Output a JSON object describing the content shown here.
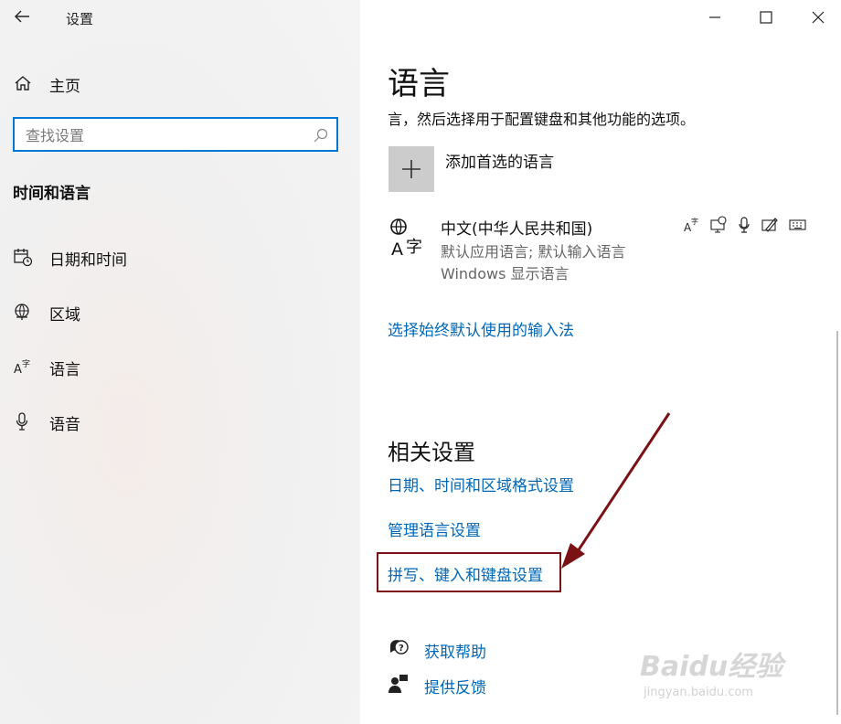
{
  "app": {
    "title": "设置"
  },
  "sidebar": {
    "home_label": "主页",
    "search_placeholder": "查找设置",
    "group_heading": "时间和语言",
    "items": [
      {
        "label": "日期和时间",
        "icon": "calendar-clock-icon"
      },
      {
        "label": "区域",
        "icon": "globe-icon"
      },
      {
        "label": "语言",
        "icon": "language-icon"
      },
      {
        "label": "语音",
        "icon": "microphone-icon"
      }
    ]
  },
  "main": {
    "title": "语言",
    "description": "言，然后选择用于配置键盘和其他功能的选项。",
    "add_language_label": "添加首选的语言",
    "language": {
      "name": "中文(中华人民共和国)",
      "line1": "默认应用语言; 默认输入语言",
      "line2": "Windows 显示语言",
      "feature_icons": [
        "display-language-icon",
        "text-to-speech-icon",
        "speech-recognition-icon",
        "handwriting-icon",
        "keyboard-icon"
      ]
    },
    "input_method_link": "选择始终默认使用的输入法",
    "related_heading": "相关设置",
    "related_links": [
      "日期、时间和区域格式设置",
      "管理语言设置",
      "拼写、键入和键盘设置"
    ],
    "help_label": "获取帮助",
    "feedback_label": "提供反馈"
  },
  "watermark": {
    "text": "Baidu经验",
    "sub": "jingyan.baidu.com"
  },
  "colors": {
    "accent": "#0078d7",
    "link": "#0067b8",
    "annotation": "#7a1115"
  }
}
